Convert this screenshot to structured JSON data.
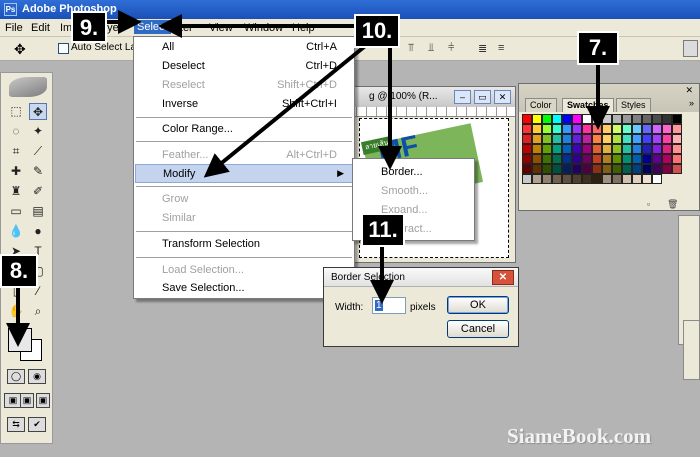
{
  "window": {
    "title": "Adobe Photoshop"
  },
  "menubar": {
    "items": [
      "File",
      "Edit",
      "Im",
      "ayer",
      "Select",
      "ilter",
      "View",
      "Window",
      "Help"
    ],
    "active": "Select"
  },
  "options_bar": {
    "auto_select_label": "Auto Select Laye"
  },
  "select_menu": {
    "items": [
      {
        "label": "All",
        "shortcut": "Ctrl+A",
        "enabled": true
      },
      {
        "label": "Deselect",
        "shortcut": "Ctrl+D",
        "enabled": true
      },
      {
        "label": "Reselect",
        "shortcut": "Shift+Ctrl+D",
        "enabled": false
      },
      {
        "label": "Inverse",
        "shortcut": "Shift+Ctrl+I",
        "enabled": true
      },
      {
        "label": "Color Range...",
        "shortcut": "",
        "enabled": true
      },
      {
        "label": "Feather...",
        "shortcut": "Alt+Ctrl+D",
        "enabled": false
      },
      {
        "label": "Modify",
        "shortcut": "",
        "enabled": true,
        "submenu": true
      },
      {
        "label": "Grow",
        "shortcut": "",
        "enabled": false
      },
      {
        "label": "Similar",
        "shortcut": "",
        "enabled": false
      },
      {
        "label": "Transform Selection",
        "shortcut": "",
        "enabled": true
      },
      {
        "label": "Load Selection...",
        "shortcut": "",
        "enabled": false
      },
      {
        "label": "Save Selection...",
        "shortcut": "",
        "enabled": true
      }
    ]
  },
  "modify_submenu": {
    "items": [
      {
        "label": "Border...",
        "enabled": true
      },
      {
        "label": "Smooth...",
        "enabled": false
      },
      {
        "label": "Expand...",
        "enabled": false
      },
      {
        "label": "Contract...",
        "enabled": false
      }
    ]
  },
  "document": {
    "title": "g @ 100% (R...",
    "logo_text": "MF",
    "logo_sub": "ลายเส้น"
  },
  "swatches_panel": {
    "tabs": [
      "Color",
      "Swatches",
      "Styles"
    ],
    "active_tab": "Swatches",
    "colors": [
      "#ff0000",
      "#ffff00",
      "#00ff00",
      "#00ffff",
      "#0000ff",
      "#ff00ff",
      "#ffffff",
      "#e6e6e6",
      "#cccccc",
      "#b3b3b3",
      "#999999",
      "#808080",
      "#666666",
      "#4d4d4d",
      "#333333",
      "#000000",
      "#ff3333",
      "#ffcc33",
      "#99ff33",
      "#33ffcc",
      "#3399ff",
      "#9933ff",
      "#ff3399",
      "#ff6666",
      "#ffcc66",
      "#ccff66",
      "#66ffcc",
      "#66ccff",
      "#6666ff",
      "#cc66ff",
      "#ff66cc",
      "#ff9999",
      "#e02020",
      "#e0a020",
      "#80c020",
      "#20c0a0",
      "#2080e0",
      "#6020e0",
      "#c020a0",
      "#ff8040",
      "#ffd060",
      "#b0e040",
      "#40e0c0",
      "#40a0ff",
      "#4040ff",
      "#a040ff",
      "#ff40a0",
      "#ffb0b0",
      "#c00000",
      "#c08000",
      "#60a000",
      "#00a080",
      "#0060c0",
      "#4000c0",
      "#a00080",
      "#e06030",
      "#e0b040",
      "#90c020",
      "#20c0a0",
      "#2080e0",
      "#2020c0",
      "#8020e0",
      "#e02080",
      "#ff9090",
      "#900000",
      "#905000",
      "#407000",
      "#007050",
      "#003090",
      "#300090",
      "#700060",
      "#c04020",
      "#b08020",
      "#609000",
      "#009070",
      "#0060b0",
      "#000090",
      "#600090",
      "#b00060",
      "#ff7070",
      "#600000",
      "#603000",
      "#305000",
      "#005040",
      "#002060",
      "#200060",
      "#500040",
      "#903010",
      "#806010",
      "#406000",
      "#006050",
      "#004080",
      "#000060",
      "#400060",
      "#800040",
      "#d05050",
      "#c8c8c8",
      "#b0a090",
      "#908070",
      "#706050",
      "#605040",
      "#504030",
      "#403020",
      "#302010",
      "#a09080",
      "#807060",
      "#d0c0b0",
      "#e0d0c0",
      "#f0e0d0",
      "#ffffff"
    ]
  },
  "border_dialog": {
    "title": "Border Selection",
    "width_label": "Width:",
    "width_value": "1",
    "unit_label": "pixels",
    "ok_label": "OK",
    "cancel_label": "Cancel"
  },
  "callouts": {
    "c7": "7.",
    "c8": "8.",
    "c9": "9.",
    "c10": "10.",
    "c11": "11."
  },
  "watermark": "SiameBook.com",
  "colors": {
    "title_blue": "#1a4fb8",
    "menu_highlight": "#c4d4ee",
    "workspace": "#b4b4b4"
  }
}
